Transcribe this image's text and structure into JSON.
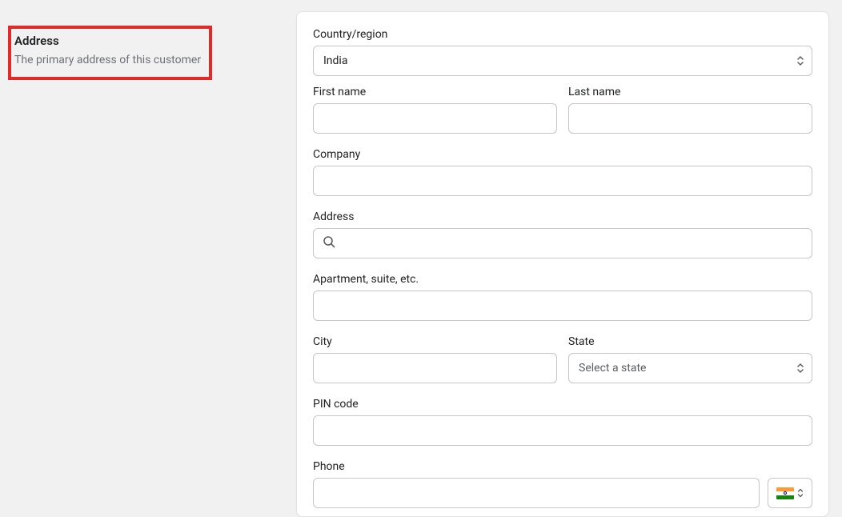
{
  "sidebar": {
    "title": "Address",
    "description": "The primary address of this customer"
  },
  "form": {
    "country_region": {
      "label": "Country/region",
      "value": "India"
    },
    "first_name": {
      "label": "First name",
      "value": ""
    },
    "last_name": {
      "label": "Last name",
      "value": ""
    },
    "company": {
      "label": "Company",
      "value": ""
    },
    "address": {
      "label": "Address",
      "value": ""
    },
    "apartment": {
      "label": "Apartment, suite, etc.",
      "value": ""
    },
    "city": {
      "label": "City",
      "value": ""
    },
    "state": {
      "label": "State",
      "placeholder": "Select a state"
    },
    "pin_code": {
      "label": "PIN code",
      "value": ""
    },
    "phone": {
      "label": "Phone",
      "value": "",
      "country_flag": "india"
    }
  }
}
